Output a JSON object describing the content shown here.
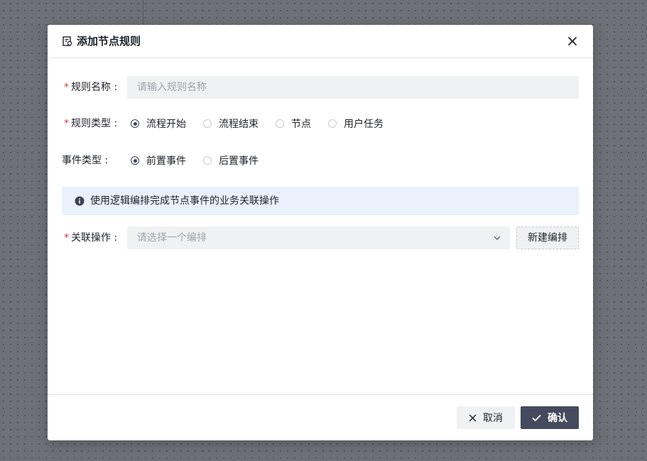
{
  "dialog": {
    "title": "添加节点规则",
    "icon": "rule-doc-icon"
  },
  "form": {
    "rule_name": {
      "label": "规则名称 :",
      "required": true,
      "placeholder": "请输入规则名称",
      "value": ""
    },
    "rule_type": {
      "label": "规则类型 :",
      "required": true,
      "options": [
        "流程开始",
        "流程结束",
        "节点",
        "用户任务"
      ],
      "selected": "流程开始"
    },
    "event_type": {
      "label": "事件类型 :",
      "required": false,
      "options": [
        "前置事件",
        "后置事件"
      ],
      "selected": "前置事件"
    },
    "info": {
      "text": "使用逻辑编排完成节点事件的业务关联操作",
      "icon": "info-icon"
    },
    "related_action": {
      "label": "关联操作 :",
      "required": true,
      "placeholder": "请选择一个编排",
      "value": "",
      "new_button": "新建编排"
    }
  },
  "footer": {
    "cancel_label": "取消",
    "confirm_label": "确认"
  },
  "colors": {
    "primary": "#454b5e",
    "required": "#e03a3a",
    "info_bg": "#e8f1fc",
    "input_bg": "#f0f1f3"
  }
}
